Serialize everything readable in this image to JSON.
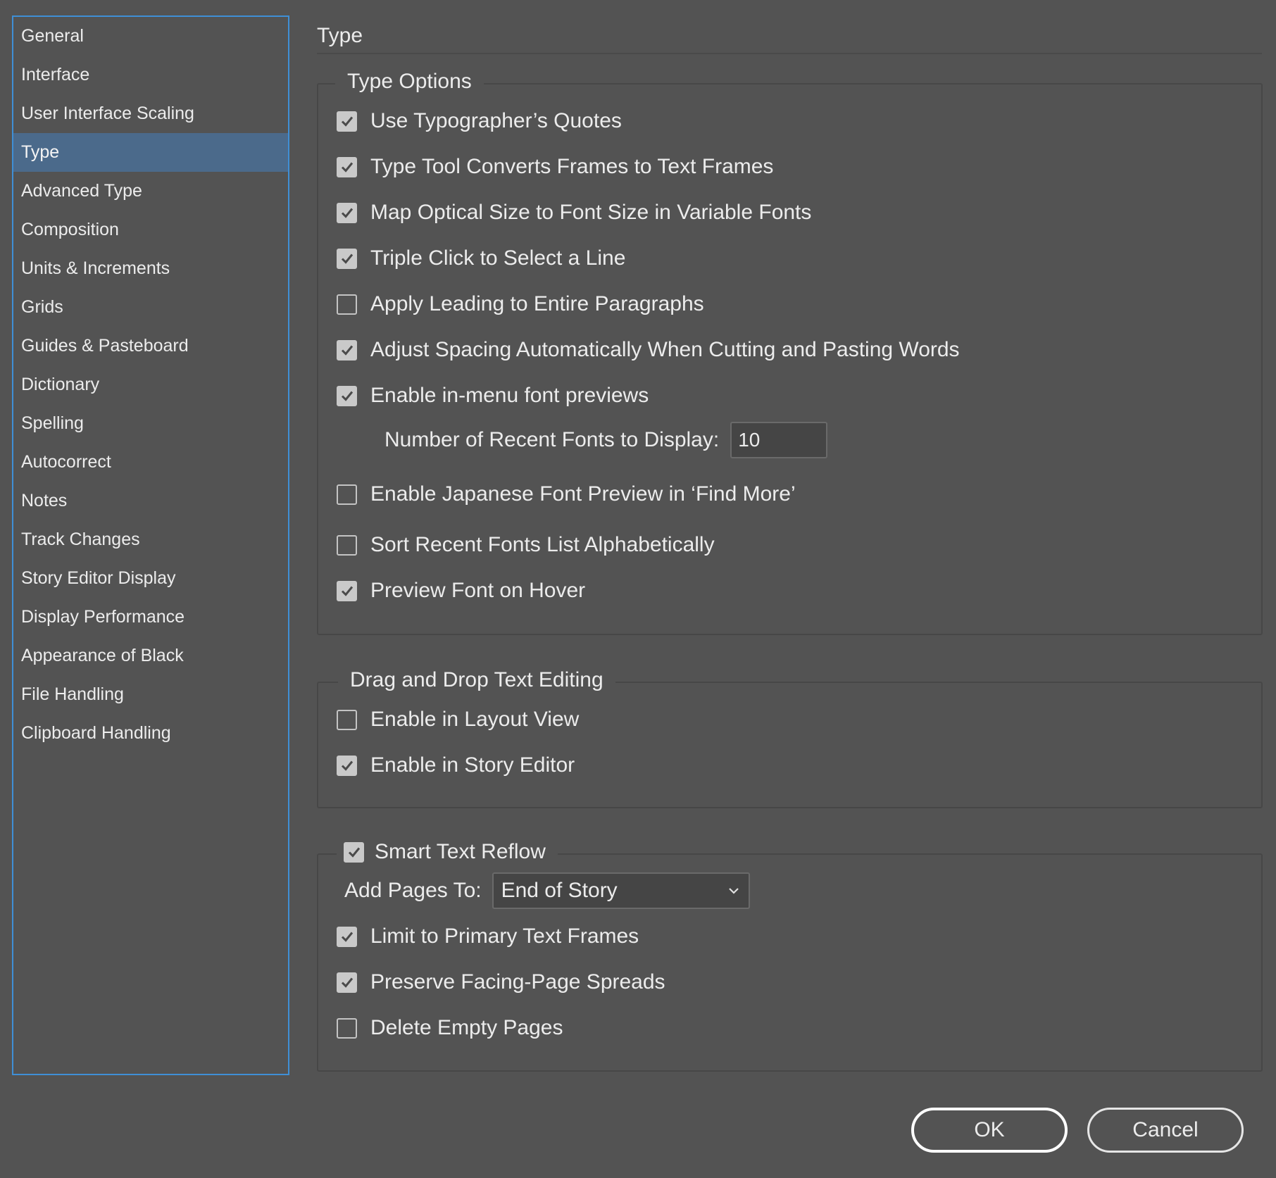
{
  "sidebar": {
    "items": [
      {
        "label": "General",
        "selected": false
      },
      {
        "label": "Interface",
        "selected": false
      },
      {
        "label": "User Interface Scaling",
        "selected": false
      },
      {
        "label": "Type",
        "selected": true
      },
      {
        "label": "Advanced Type",
        "selected": false
      },
      {
        "label": "Composition",
        "selected": false
      },
      {
        "label": "Units & Increments",
        "selected": false
      },
      {
        "label": "Grids",
        "selected": false
      },
      {
        "label": "Guides & Pasteboard",
        "selected": false
      },
      {
        "label": "Dictionary",
        "selected": false
      },
      {
        "label": "Spelling",
        "selected": false
      },
      {
        "label": "Autocorrect",
        "selected": false
      },
      {
        "label": "Notes",
        "selected": false
      },
      {
        "label": "Track Changes",
        "selected": false
      },
      {
        "label": "Story Editor Display",
        "selected": false
      },
      {
        "label": "Display Performance",
        "selected": false
      },
      {
        "label": "Appearance of Black",
        "selected": false
      },
      {
        "label": "File Handling",
        "selected": false
      },
      {
        "label": "Clipboard Handling",
        "selected": false
      }
    ]
  },
  "main": {
    "title": "Type",
    "type_options": {
      "legend": "Type Options",
      "items": [
        {
          "label": "Use Typographer’s Quotes",
          "checked": true
        },
        {
          "label": "Type Tool Converts Frames to Text Frames",
          "checked": true
        },
        {
          "label": "Map Optical Size to Font Size in Variable Fonts",
          "checked": true
        },
        {
          "label": "Triple Click to Select a Line",
          "checked": true
        },
        {
          "label": "Apply Leading to Entire Paragraphs",
          "checked": false
        },
        {
          "label": "Adjust Spacing Automatically When Cutting and Pasting Words",
          "checked": true
        },
        {
          "label": "Enable in-menu font previews",
          "checked": true
        },
        {
          "label": "Enable Japanese Font Preview in ‘Find More’",
          "checked": false
        },
        {
          "label": "Sort Recent Fonts List Alphabetically",
          "checked": false
        },
        {
          "label": "Preview Font on Hover",
          "checked": true
        }
      ],
      "recent_fonts": {
        "label": "Number of Recent Fonts to Display:",
        "value": "10"
      }
    },
    "drag_drop": {
      "legend": "Drag and Drop Text Editing",
      "items": [
        {
          "label": "Enable in Layout View",
          "checked": false
        },
        {
          "label": "Enable in Story Editor",
          "checked": true
        }
      ]
    },
    "smart_reflow": {
      "legend": "Smart Text Reflow",
      "checked": true,
      "add_pages": {
        "label": "Add Pages To:",
        "value": "End of Story"
      },
      "items": [
        {
          "label": "Limit to Primary Text Frames",
          "checked": true
        },
        {
          "label": "Preserve Facing-Page Spreads",
          "checked": true
        },
        {
          "label": "Delete Empty Pages",
          "checked": false
        }
      ]
    }
  },
  "buttons": {
    "ok": "OK",
    "cancel": "Cancel"
  },
  "icons": {
    "check": "checkmark-icon",
    "dropdown": "chevron-down-icon"
  },
  "colors": {
    "background": "#535353",
    "selection": "#4b6a8b",
    "sidebar_border": "#3f8fd6"
  }
}
